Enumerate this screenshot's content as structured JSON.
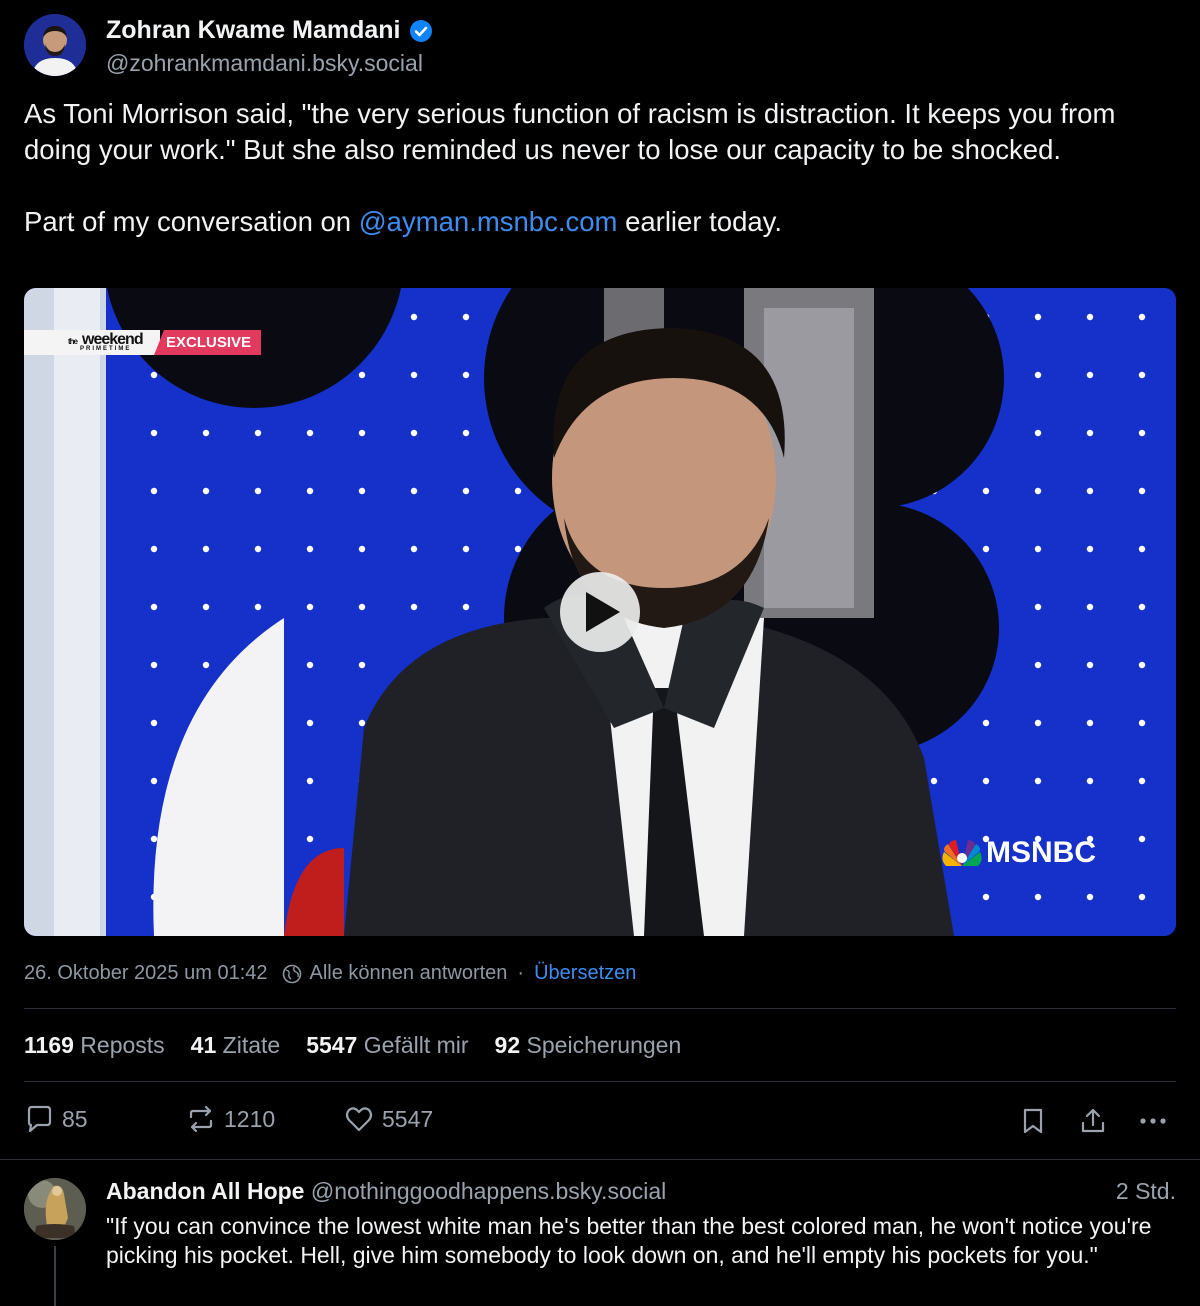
{
  "post": {
    "author": {
      "display_name": "Zohran Kwame Mamdani",
      "handle": "@zohrankmamdani.bsky.social",
      "verified": true,
      "avatar_icon": "user-avatar-icon"
    },
    "text": {
      "paragraph1": "As Toni Morrison said, \"the very serious function of racism is distraction. It keeps you from doing your work.\" But she also reminded us never to lose our capacity to be shocked.",
      "paragraph2_prefix": "Part of my conversation on ",
      "paragraph2_mention": "@ayman.msnbc.com",
      "paragraph2_suffix": " earlier today."
    },
    "video": {
      "brand_weekend": "weekend",
      "brand_the": "the",
      "brand_primetime": "PRIMETIME",
      "brand_tag": "EXCLUSIVE",
      "network_logo": "MSNBC",
      "play_icon": "play-icon"
    },
    "meta": {
      "timestamp": "26. Oktober 2025 um 01:42",
      "reply_setting": "Alle können antworten",
      "separator": "·",
      "translate": "Übersetzen"
    },
    "stats": {
      "reposts_count": "1169",
      "reposts_label": "Reposts",
      "quotes_count": "41",
      "quotes_label": "Zitate",
      "likes_count": "5547",
      "likes_label": "Gefällt mir",
      "saves_count": "92",
      "saves_label": "Speicherungen"
    },
    "actions": {
      "replies": "85",
      "reposts": "1210",
      "likes": "5547"
    }
  },
  "reply": {
    "display_name": "Abandon All Hope",
    "handle": "@nothinggoodhappens.bsky.social",
    "time": "2 Std.",
    "text": "\"If you can convince the lowest white man he's better than the best colored man, he won't notice you're picking his pocket. Hell, give him somebody to look down on, and he'll empty his pockets for you.\""
  },
  "colors": {
    "background": "#000000",
    "text": "#f1f3f5",
    "muted": "#9aa3ad",
    "link": "#3f8cf0",
    "verified": "#1083fe",
    "divider": "#2a2f36",
    "video_blue": "#1530c8",
    "exclusive_pink": "#e23a5f"
  }
}
